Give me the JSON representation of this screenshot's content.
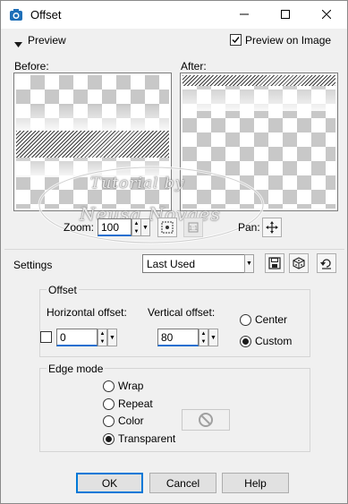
{
  "window": {
    "title": "Offset",
    "minimize_icon": "minimize-icon",
    "maximize_icon": "maximize-icon",
    "close_icon": "close-icon"
  },
  "preview": {
    "toggle_label": "Preview",
    "preview_on_image_label": "Preview on Image",
    "preview_on_image_checked": true,
    "before_label": "Before:",
    "after_label": "After:",
    "zoom_label": "Zoom:",
    "zoom_value": "100",
    "pan_label": "Pan:"
  },
  "settings": {
    "label": "Settings",
    "preset_value": "Last Used"
  },
  "offset": {
    "group_label": "Offset",
    "horizontal_label": "Horizontal offset:",
    "horizontal_value": "0",
    "vertical_label": "Vertical offset:",
    "vertical_value": "80",
    "center_label": "Center",
    "custom_label": "Custom",
    "selected": "Custom"
  },
  "edge_mode": {
    "group_label": "Edge mode",
    "options": [
      "Wrap",
      "Repeat",
      "Color",
      "Transparent"
    ],
    "selected": "Transparent"
  },
  "buttons": {
    "ok": "OK",
    "cancel": "Cancel",
    "help": "Help"
  },
  "watermark": {
    "line1": "Tutorial by",
    "line2": "Neusa Novaes"
  },
  "colors": {
    "accent": "#0078d7",
    "dialog_bg": "#f0f0f0"
  }
}
